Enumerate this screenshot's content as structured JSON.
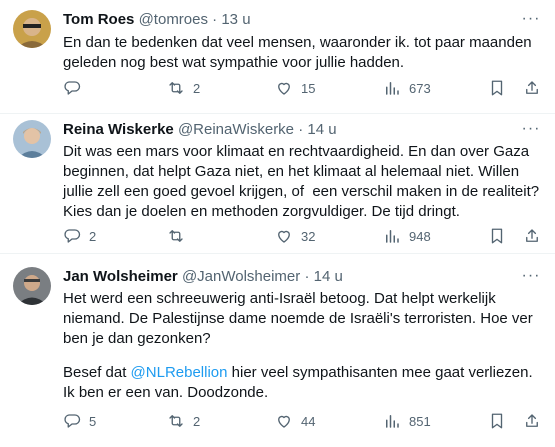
{
  "tweets": [
    {
      "name": "Tom Roes",
      "handle": "@tomroes",
      "time": "13 u",
      "text": "En dan te bedenken dat veel mensen, waaronder ik. tot paar maanden geleden nog best wat sympathie voor jullie hadden.",
      "replies": "",
      "retweets": "2",
      "likes": "15",
      "views": "673",
      "avatar_color": "#c9a14a"
    },
    {
      "name": "Reina Wiskerke",
      "handle": "@ReinaWiskerke",
      "time": "14 u",
      "text": "Dit was een mars voor klimaat en rechtvaardigheid. En dan over Gaza beginnen, dat helpt Gaza niet, en het klimaat al helemaal niet. Willen jullie zell een goed gevoel krijgen, of  een verschil maken in de realiteit? Kies dan je doelen en methoden zorgvuldiger. De tijd dringt.",
      "replies": "2",
      "retweets": "",
      "likes": "32",
      "views": "948",
      "avatar_color": "#9fb6c9"
    },
    {
      "name": "Jan Wolsheimer",
      "handle": "@JanWolsheimer",
      "time": "14 u",
      "text_1": "Het werd een schreeuwerig anti-Israël betoog. Dat helpt werkelijk niemand. De Palestijnse dame noemde de Israëli's terroristen. Hoe ver ben je dan gezonken?",
      "text_2_pre": "Besef dat ",
      "text_2_mention": "@NLRebellion",
      "text_2_post": " hier veel sympathisanten mee gaat verliezen. Ik ben er een van. Doodzonde.",
      "replies": "5",
      "retweets": "2",
      "likes": "44",
      "views": "851",
      "avatar_color": "#6b6f73"
    }
  ],
  "separator": "·",
  "more_label": "···",
  "colors": {
    "text": "#0f1419",
    "muted": "#536471",
    "link": "#1d9bf0",
    "divider": "#eff3f4"
  },
  "icons": [
    "reply-icon",
    "retweet-icon",
    "like-icon",
    "views-icon",
    "bookmark-icon",
    "share-icon",
    "more-icon"
  ]
}
